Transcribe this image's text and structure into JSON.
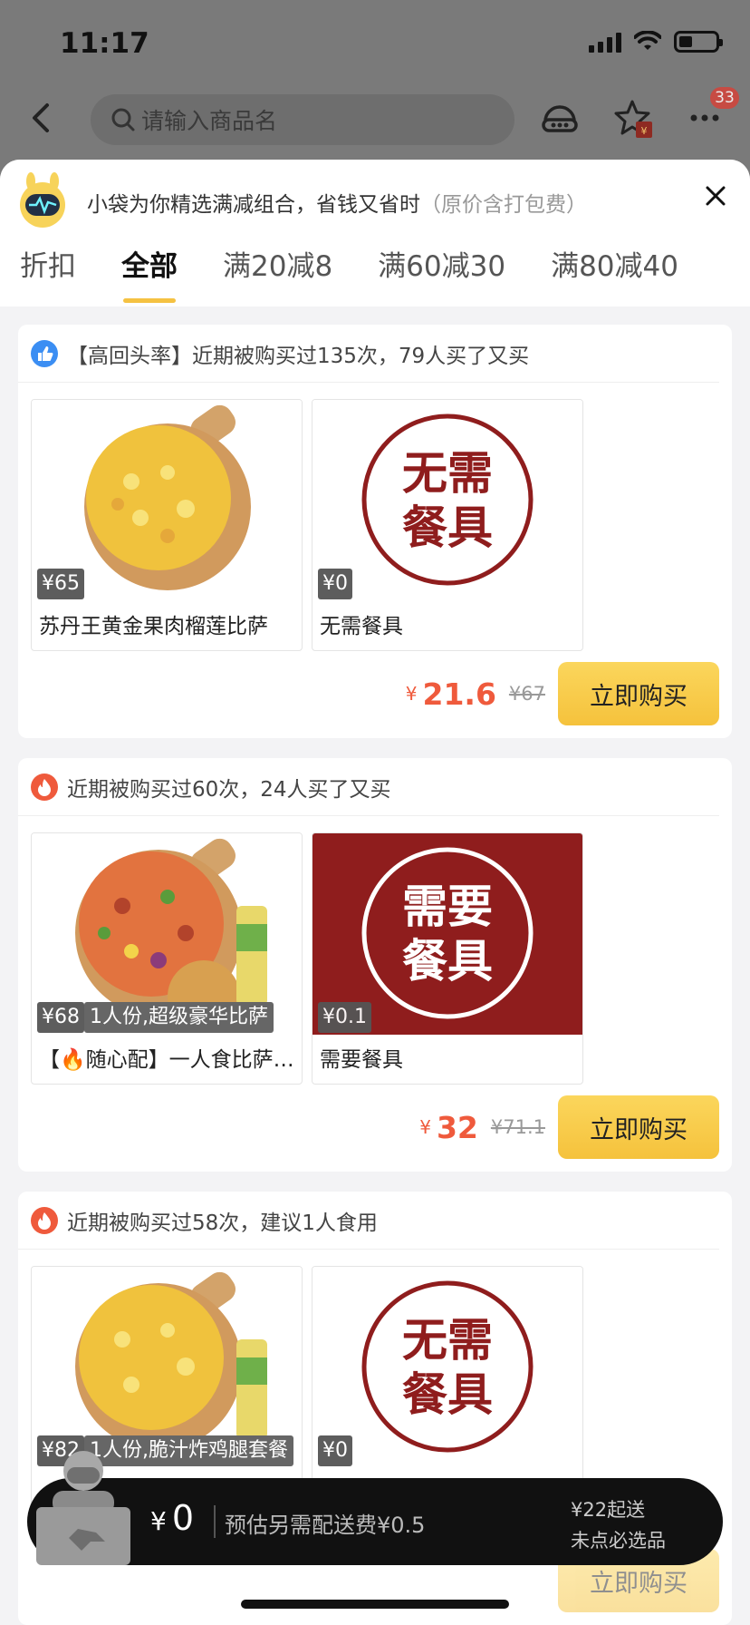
{
  "status_bar": {
    "time": "11:17"
  },
  "top_bar": {
    "search_placeholder": "请输入商品名",
    "badge_count": "33"
  },
  "sheet": {
    "intro": "小袋为你精选满减组合，省钱又省时",
    "intro_note": "（原价含打包费）",
    "tabs": [
      {
        "label": "折扣"
      },
      {
        "label": "全部"
      },
      {
        "label": "满20减8"
      },
      {
        "label": "满60减30"
      },
      {
        "label": "满80减40"
      }
    ],
    "active_tab": "全部"
  },
  "combos": [
    {
      "header": "【高回头率】近期被购买过135次，79人买了又买",
      "header_icon": "thumbs-up-icon",
      "items": [
        {
          "price": "¥65",
          "name": "苏丹王黄金果肉榴莲比萨",
          "image": "pineapple-pizza",
          "desc": ""
        },
        {
          "price": "¥0",
          "name": "无需餐具",
          "image": "no-utensils-sticker",
          "desc": ""
        }
      ],
      "currency": "¥",
      "price": "21.6",
      "original_price": "¥67",
      "buy_label": "立即购买"
    },
    {
      "header": "近期被购买过60次，24人买了又买",
      "header_icon": "flame-icon",
      "items": [
        {
          "price": "¥68",
          "desc": "1人份,超级豪华比萨",
          "name": "【🔥随心配】一人食比萨套餐",
          "image": "supreme-pizza"
        },
        {
          "price": "¥0.1",
          "name": "需要餐具",
          "image": "need-utensils-sticker",
          "desc": ""
        }
      ],
      "currency": "¥",
      "price": "32",
      "original_price": "¥71.1",
      "buy_label": "立即购买"
    },
    {
      "header": "近期被购买过58次，建议1人食用",
      "header_icon": "flame-icon",
      "items": [
        {
          "price": "¥82",
          "desc": "1人份,脆汁炸鸡腿套餐",
          "name": "",
          "image": "pineapple-pizza-drink"
        },
        {
          "price": "¥0",
          "name": "",
          "image": "no-utensils-sticker",
          "desc": ""
        }
      ],
      "currency": "¥",
      "price": "",
      "original_price": "",
      "buy_label": "立即购买"
    }
  ],
  "stickers": {
    "no_utensils": [
      "无需",
      "餐具"
    ],
    "need_utensils": [
      "需要",
      "餐具"
    ]
  },
  "cart": {
    "currency": "¥",
    "total": "0",
    "delivery_note": "预估另需配送费¥0.5",
    "min_order": "¥22起送",
    "required_note": "未点必选品"
  },
  "colors": {
    "accent_yellow": "#f5c242",
    "price_red": "#ef5a3c",
    "sticker_red": "#8f1d1d"
  }
}
